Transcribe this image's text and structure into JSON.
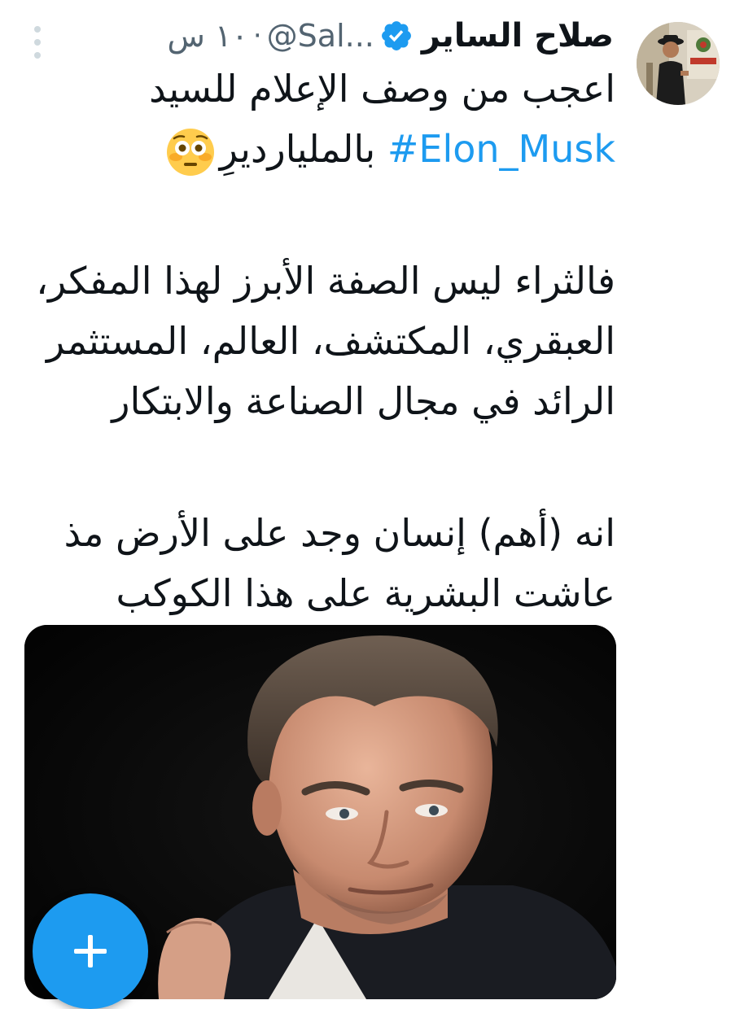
{
  "tweet": {
    "author": {
      "display_name": "صلاح الساير",
      "handle": "@Sal...",
      "verified": true
    },
    "separator": "·",
    "time": "١٠ س",
    "text": {
      "line1": "اعجب من وصف الإعلام للسيد",
      "hashtag": "#Elon_Musk",
      "line2_rest": " بالمليارديرِ",
      "emoji": "flushed-face",
      "paragraph2": "فالثراء ليس الصفة الأبرز لهذا المفكر، العبقري، المكتشف، العالم، المستثمر الرائد في مجال الصناعة والابتكار",
      "paragraph3": "انه (أهم) إنسان وجد على الأرض مذ عاشت البشرية على هذا الكوكب"
    }
  },
  "icons": {
    "verified": "verified-badge-icon",
    "more": "more-vertical-icon",
    "compose": "plus-icon"
  },
  "colors": {
    "accent": "#1d9bf0",
    "text": "#0f1419",
    "secondary": "#536471"
  }
}
